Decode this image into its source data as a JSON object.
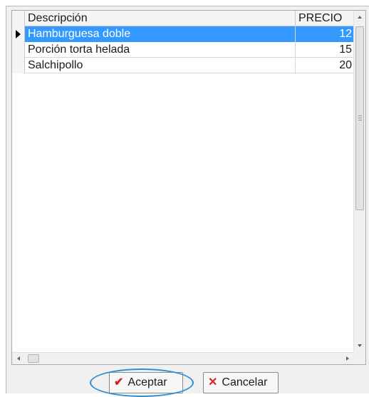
{
  "grid": {
    "columns": {
      "descripcion": "Descripción",
      "precio": "PRECIO"
    },
    "rows": [
      {
        "descripcion": "Hamburguesa doble",
        "precio": "12",
        "selected": true
      },
      {
        "descripcion": "Porción torta helada",
        "precio": "15",
        "selected": false
      },
      {
        "descripcion": "Salchipollo",
        "precio": "20",
        "selected": false
      }
    ],
    "selection_color": "#3399ff"
  },
  "buttons": {
    "aceptar": {
      "label": "Aceptar",
      "icon": "checkmark-icon",
      "icon_color": "#d42020"
    },
    "cancelar": {
      "label": "Cancelar",
      "icon": "x-icon",
      "icon_color": "#e02020"
    }
  },
  "highlight_color": "#2a8fd4"
}
